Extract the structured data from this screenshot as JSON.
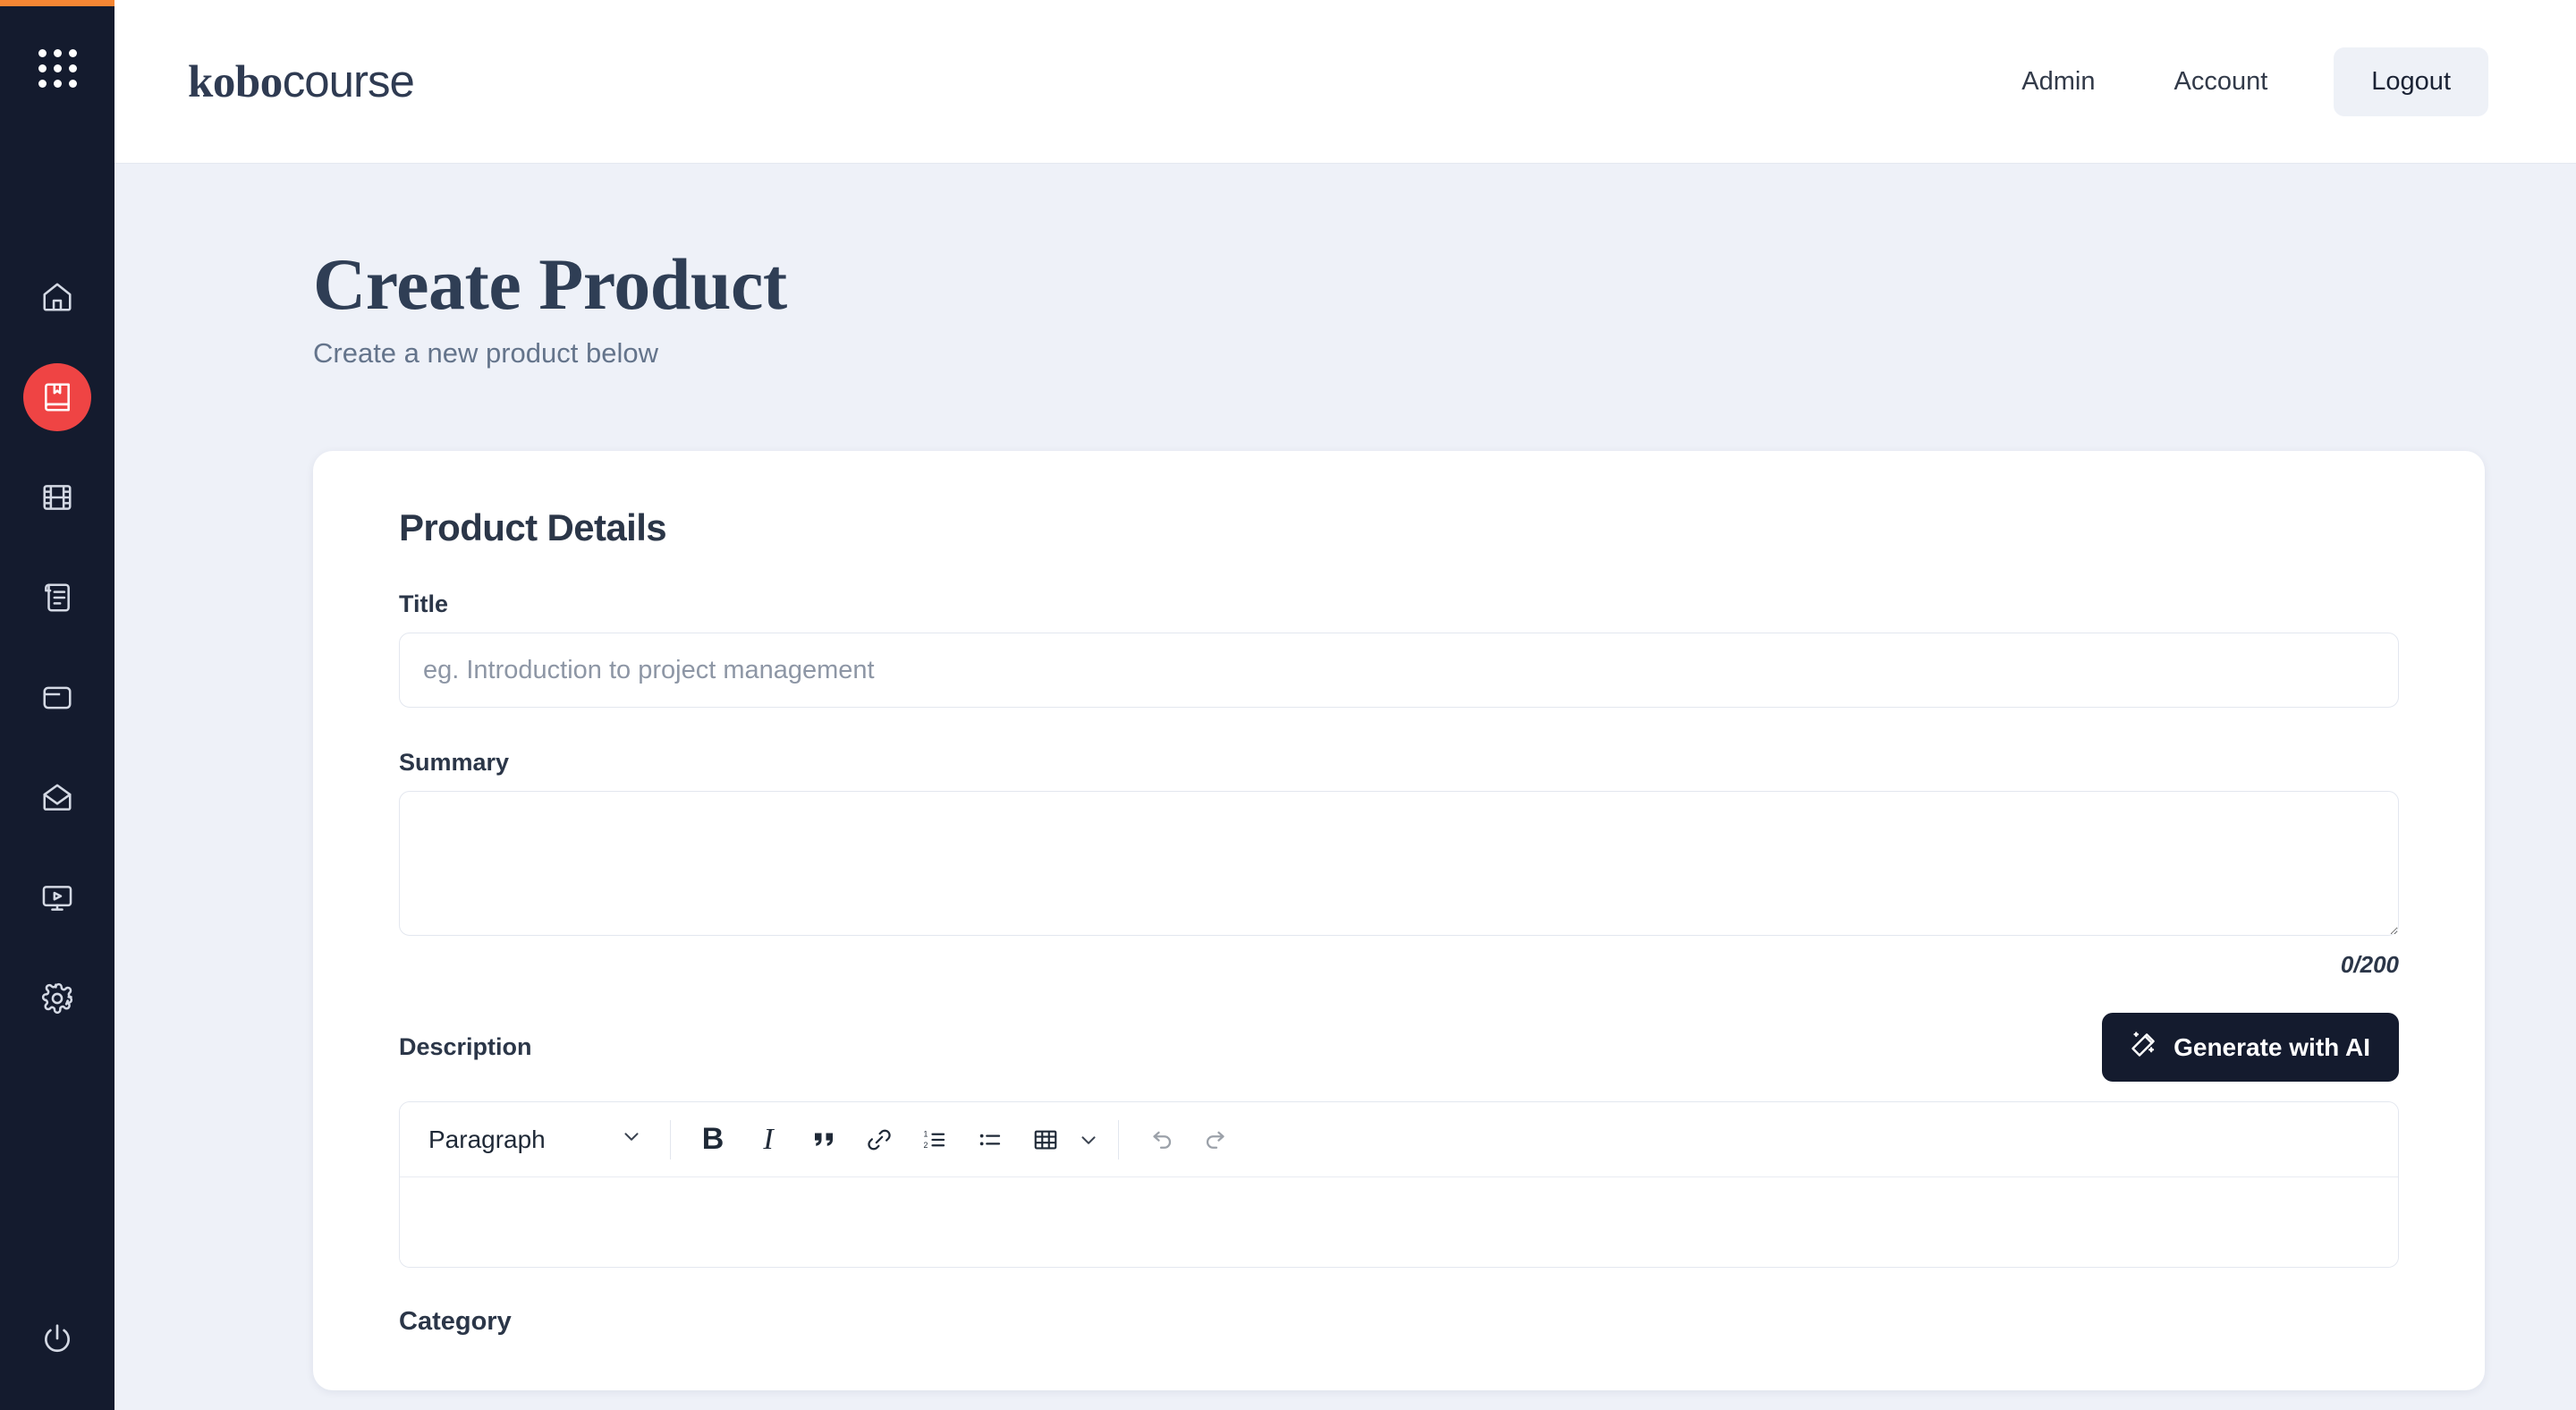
{
  "brand": {
    "name_bold": "kobo",
    "name_light": "course"
  },
  "topnav": {
    "admin": "Admin",
    "account": "Account",
    "logout": "Logout"
  },
  "sidebar": {
    "accent_color": "#f58634",
    "background_color": "#141b2e",
    "active_color": "#ef4444",
    "apps_icon": "grid-dots-icon",
    "items": [
      {
        "icon": "home-icon",
        "active": false
      },
      {
        "icon": "book-bookmark-icon",
        "active": true
      },
      {
        "icon": "film-strip-icon",
        "active": false
      },
      {
        "icon": "scroll-document-icon",
        "active": false
      },
      {
        "icon": "card-wallet-icon",
        "active": false
      },
      {
        "icon": "envelope-mail-icon",
        "active": false
      },
      {
        "icon": "monitor-play-icon",
        "active": false
      },
      {
        "icon": "gear-settings-icon",
        "active": false
      }
    ],
    "power_icon": "power-icon"
  },
  "page": {
    "title": "Create Product",
    "subtitle": "Create a new product below"
  },
  "form": {
    "card_title": "Product Details",
    "title_label": "Title",
    "title_value": "",
    "title_placeholder": "eg. Introduction to project management",
    "summary_label": "Summary",
    "summary_value": "",
    "summary_placeholder": "",
    "summary_counter": "0/200",
    "description_label": "Description",
    "generate_ai_label": "Generate with AI",
    "generate_ai_icon": "magic-wand-icon",
    "category_label": "Category",
    "editor": {
      "block_type": "Paragraph",
      "buttons": [
        {
          "name": "bold",
          "glyph": "B"
        },
        {
          "name": "italic",
          "glyph": "I"
        },
        {
          "name": "blockquote",
          "glyph": "“"
        },
        {
          "name": "link",
          "glyph": "link-icon"
        },
        {
          "name": "ordered-list",
          "glyph": "ordered-list-icon"
        },
        {
          "name": "bullet-list",
          "glyph": "bullet-list-icon"
        },
        {
          "name": "table",
          "glyph": "table-icon"
        },
        {
          "name": "undo",
          "glyph": "undo-icon"
        },
        {
          "name": "redo",
          "glyph": "redo-icon"
        }
      ],
      "content": ""
    }
  }
}
